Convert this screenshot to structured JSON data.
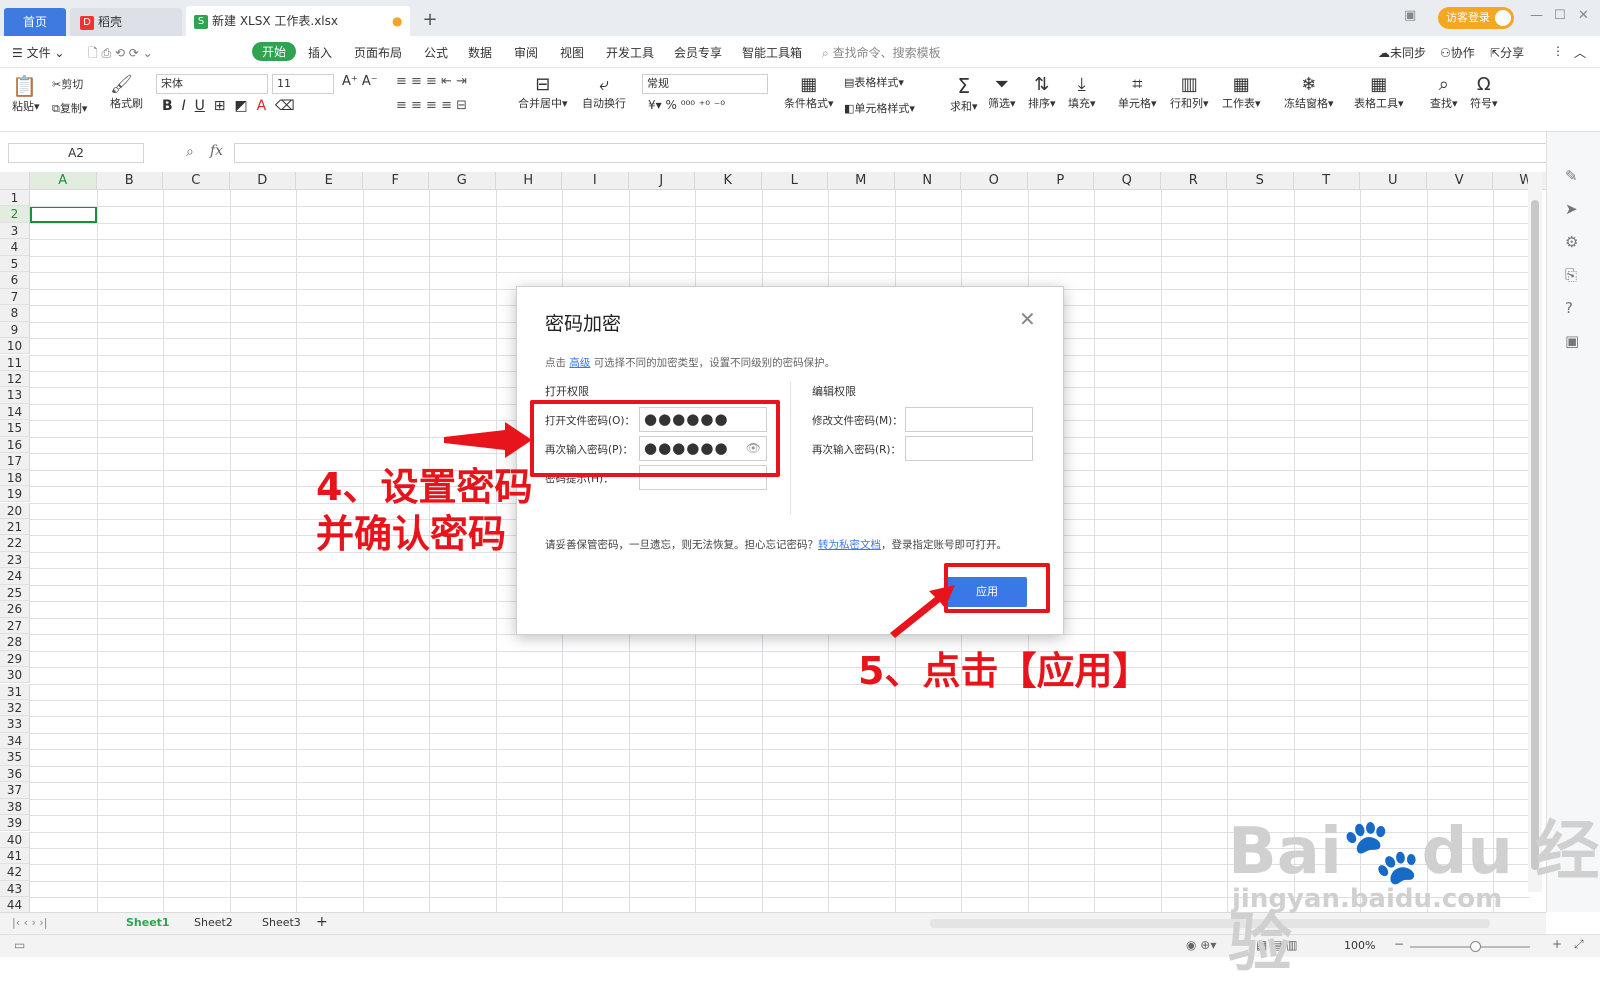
{
  "tabs": {
    "home": "首页",
    "doc": "稻壳",
    "file": "新建 XLSX 工作表.xlsx",
    "login": "访客登录"
  },
  "menu": {
    "file": "文件",
    "items": [
      "开始",
      "插入",
      "页面布局",
      "公式",
      "数据",
      "审阅",
      "视图",
      "开发工具",
      "会员专享",
      "智能工具箱"
    ],
    "search": "查找命令、搜索模板",
    "sync": "未同步",
    "collab": "协作",
    "share": "分享"
  },
  "ribbon": {
    "paste": "粘贴",
    "cut": "剪切",
    "copy": "复制",
    "format_painter": "格式刷",
    "font_name": "宋体",
    "font_size": "11",
    "number_format": "常规",
    "merge": "合并居中",
    "wrap": "自动换行",
    "cond_format": "条件格式",
    "table_style": "表格样式",
    "cell_style": "单元格样式",
    "sum": "求和",
    "filter": "筛选",
    "sort": "排序",
    "fill": "填充",
    "cell": "单元格",
    "rowcol": "行和列",
    "sheet": "工作表",
    "freeze": "冻结窗格",
    "table_tools": "表格工具",
    "find": "查找",
    "symbol": "符号"
  },
  "formula": {
    "name_box": "A2",
    "fx": "fx"
  },
  "grid": {
    "columns": [
      "A",
      "B",
      "C",
      "D",
      "E",
      "F",
      "G",
      "H",
      "I",
      "J",
      "K",
      "L",
      "M",
      "N",
      "O",
      "P",
      "Q",
      "R",
      "S",
      "T",
      "U",
      "V",
      "W"
    ],
    "rows": [
      "1",
      "2",
      "3",
      "4",
      "5",
      "6",
      "7",
      "8",
      "9",
      "10",
      "11",
      "12",
      "13",
      "14",
      "15",
      "16",
      "17",
      "18",
      "19",
      "20",
      "21",
      "22",
      "23",
      "24",
      "25",
      "26",
      "27",
      "28",
      "29",
      "30",
      "31",
      "32",
      "33",
      "34",
      "35",
      "36",
      "37",
      "38",
      "39",
      "40",
      "41",
      "42",
      "43",
      "44"
    ]
  },
  "sheets": {
    "s1": "Sheet1",
    "s2": "Sheet2",
    "s3": "Sheet3"
  },
  "status": {
    "zoom": "100%"
  },
  "dialog": {
    "title": "密码加密",
    "hint_pre": "点击",
    "hint_link": "高级",
    "hint_post": "可选择不同的加密类型，设置不同级别的密码保护。",
    "open_section": "打开权限",
    "edit_section": "编辑权限",
    "open_pwd_label": "打开文件密码(O)：",
    "open_pwd_confirm_label": "再次输入密码(P)：",
    "pwd_hint_label": "密码提示(H)：",
    "edit_pwd_label": "修改文件密码(M)：",
    "edit_pwd_confirm_label": "再次输入密码(R)：",
    "open_pwd_value": "●●●●●●",
    "open_pwd_confirm_value": "●●●●●●",
    "warn_pre": "请妥善保管密码，一旦遗忘，则无法恢复。担心忘记密码？",
    "warn_link": "转为私密文档",
    "warn_post": "，登录指定账号即可打开。",
    "apply": "应用"
  },
  "annotations": {
    "step4_line1": "4、设置密码",
    "step4_line2": "并确认密码",
    "step5": "5、点击【应用】"
  },
  "watermark": {
    "brand": "Bai",
    "brand2": "du",
    "site": "经验",
    "url": "jingyan.baidu.com"
  },
  "colors": {
    "accent_green": "#2ea44f",
    "dialog_blue": "#3b78e7",
    "annotation_red": "#e8141b"
  }
}
